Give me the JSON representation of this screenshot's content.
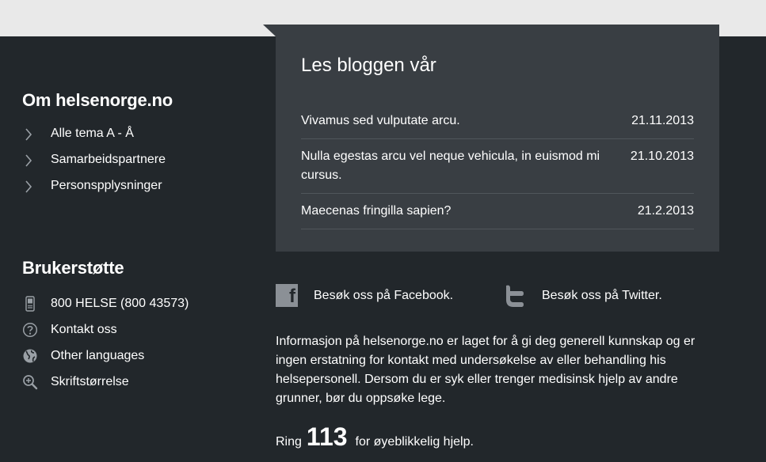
{
  "about": {
    "title": "Om helsenorge.no",
    "links": [
      {
        "label": "Alle tema A - Å",
        "icon": "chevron-right-icon"
      },
      {
        "label": "Samarbeidspartnere",
        "icon": "chevron-right-icon"
      },
      {
        "label": "Personspplysninger",
        "icon": "chevron-right-icon"
      }
    ]
  },
  "support": {
    "title": "Brukerstøtte",
    "items": [
      {
        "label": "800 HELSE (800 43573)",
        "icon": "phone-icon"
      },
      {
        "label": "Kontakt oss",
        "icon": "question-icon"
      },
      {
        "label": "Other languages",
        "icon": "globe-icon"
      },
      {
        "label": "Skriftstørrelse",
        "icon": "zoom-icon"
      }
    ]
  },
  "blog": {
    "title": "Les bloggen vår",
    "posts": [
      {
        "title": "Vivamus sed vulputate arcu.",
        "date": "21.11.2013"
      },
      {
        "title": "Nulla egestas arcu vel neque vehicula, in euismod mi cursus.",
        "date": "21.10.2013"
      },
      {
        "title": "Maecenas fringilla sapien?",
        "date": "21.2.2013"
      }
    ]
  },
  "social": {
    "facebook": {
      "label": "Besøk oss på Facebook.",
      "icon": "facebook-icon"
    },
    "twitter": {
      "label": "Besøk oss på Twitter.",
      "icon": "twitter-icon"
    }
  },
  "info": "Informasjon på helsenorge.no er laget for å gi deg generell kunnskap og er ingen erstatning for kontakt med undersøkelse av eller behandling his helsepersonell. Dersom du er syk eller trenger medisinsk hjelp av andre grunner, bør du oppsøke lege.",
  "emergency": {
    "prefix": "Ring",
    "number": "113",
    "suffix": "for øyeblikkelig hjelp."
  },
  "colors": {
    "footer_bg": "#22272b",
    "panel_bg": "#393e43",
    "icon_gray": "#8b9096",
    "top_bg": "#e9e9e9"
  }
}
